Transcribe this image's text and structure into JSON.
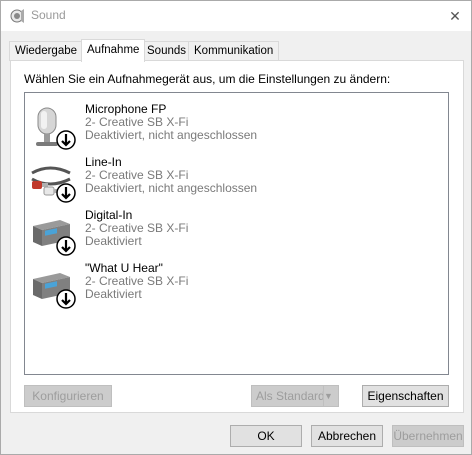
{
  "window": {
    "title": "Sound",
    "close_glyph": "✕"
  },
  "tabs": [
    {
      "label": "Wiedergabe",
      "active": false
    },
    {
      "label": "Aufnahme",
      "active": true
    },
    {
      "label": "Sounds",
      "active": false
    },
    {
      "label": "Kommunikation",
      "active": false
    }
  ],
  "panel": {
    "instruction": "Wählen Sie ein Aufnahmegerät aus, um die Einstellungen zu ändern:"
  },
  "devices": [
    {
      "name": "Microphone FP",
      "driver": "2- Creative SB X-Fi",
      "status": "Deaktiviert, nicht angeschlossen",
      "icon": "microphone-icon"
    },
    {
      "name": "Line-In",
      "driver": "2- Creative SB X-Fi",
      "status": "Deaktiviert, nicht angeschlossen",
      "icon": "line-in-cable-icon"
    },
    {
      "name": "Digital-In",
      "driver": "2- Creative SB X-Fi",
      "status": "Deaktiviert",
      "icon": "sound-card-icon"
    },
    {
      "name": "\"What U Hear\"",
      "driver": "2- Creative SB X-Fi",
      "status": "Deaktiviert",
      "icon": "sound-card-icon"
    }
  ],
  "buttons": {
    "configure": "Konfigurieren",
    "default": "Als Standard",
    "properties": "Eigenschaften",
    "ok": "OK",
    "cancel": "Abbrechen",
    "apply": "Übernehmen"
  },
  "colors": {
    "status_text": "#7a7a7a",
    "down_arrow_badge": "#000000"
  }
}
